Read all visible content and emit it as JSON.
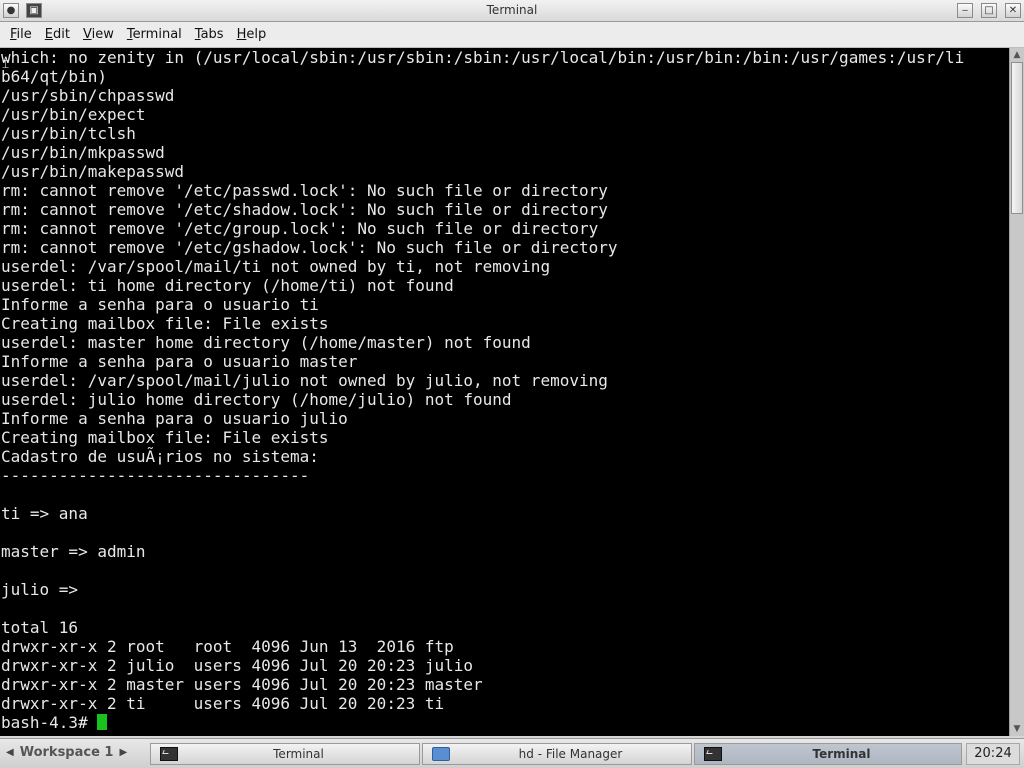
{
  "window": {
    "title": "Terminal"
  },
  "menu": {
    "items": [
      {
        "accel": "F",
        "rest": "ile"
      },
      {
        "accel": "E",
        "rest": "dit"
      },
      {
        "accel": "V",
        "rest": "iew"
      },
      {
        "accel": "T",
        "rest": "erminal"
      },
      {
        "accel": "T",
        "rest": "abs"
      },
      {
        "accel": "H",
        "rest": "elp"
      }
    ]
  },
  "terminal": {
    "lines": [
      "which: no zenity in (/usr/local/sbin:/usr/sbin:/sbin:/usr/local/bin:/usr/bin:/bin:/usr/games:/usr/li",
      "b64/qt/bin)",
      "/usr/sbin/chpasswd",
      "/usr/bin/expect",
      "/usr/bin/tclsh",
      "/usr/bin/mkpasswd",
      "/usr/bin/makepasswd",
      "rm: cannot remove '/etc/passwd.lock': No such file or directory",
      "rm: cannot remove '/etc/shadow.lock': No such file or directory",
      "rm: cannot remove '/etc/group.lock': No such file or directory",
      "rm: cannot remove '/etc/gshadow.lock': No such file or directory",
      "userdel: /var/spool/mail/ti not owned by ti, not removing",
      "userdel: ti home directory (/home/ti) not found",
      "Informe a senha para o usuario ti",
      "Creating mailbox file: File exists",
      "userdel: master home directory (/home/master) not found",
      "Informe a senha para o usuario master",
      "userdel: /var/spool/mail/julio not owned by julio, not removing",
      "userdel: julio home directory (/home/julio) not found",
      "Informe a senha para o usuario julio",
      "Creating mailbox file: File exists",
      "Cadastro de usuÃ¡rios no sistema:",
      "--------------------------------",
      "",
      "ti => ana",
      "",
      "master => admin",
      "",
      "julio =>",
      "",
      "total 16",
      "drwxr-xr-x 2 root   root  4096 Jun 13  2016 ftp",
      "drwxr-xr-x 2 julio  users 4096 Jul 20 20:23 julio",
      "drwxr-xr-x 2 master users 4096 Jul 20 20:23 master",
      "drwxr-xr-x 2 ti     users 4096 Jul 20 20:23 ti"
    ],
    "prompt": "bash-4.3# "
  },
  "taskbar": {
    "workspace": "Workspace 1",
    "tasks": [
      {
        "label": "Terminal",
        "icon": "terminal-icon",
        "active": false
      },
      {
        "label": "hd - File Manager",
        "icon": "folder-icon",
        "active": false
      },
      {
        "label": "Terminal",
        "icon": "terminal-icon",
        "active": true
      }
    ],
    "clock": "20:24"
  }
}
